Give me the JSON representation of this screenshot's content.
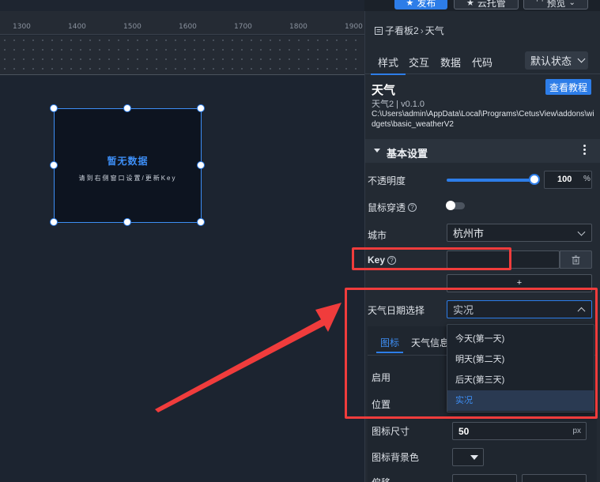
{
  "toolbar": {
    "publish_label": "发布",
    "host_label": "云托管",
    "preview_label": "预览"
  },
  "ruler": {
    "ticks": [
      "1300",
      "1400",
      "1500",
      "1600",
      "1700",
      "1800",
      "1900"
    ]
  },
  "widget": {
    "no_data_title": "暂无数据",
    "no_data_hint": "请到右侧窗口设置/更新Key"
  },
  "panel": {
    "breadcrumb_parent": "子看板2",
    "breadcrumb_current": "天气",
    "tabs": [
      "样式",
      "交互",
      "数据",
      "代码"
    ],
    "state_select": "默认状态",
    "widget_name": "天气",
    "tutorial_label": "查看教程",
    "widget_version": "天气2 | v0.1.0",
    "widget_path": "C:\\Users\\admin\\AppData\\Local\\Programs\\CetusView\\addons\\widgets\\basic_weatherV2",
    "section_title": "基本设置",
    "opacity": {
      "label": "不透明度",
      "value": "100",
      "unit": "%",
      "fraction": 1.0
    },
    "mouse_through": {
      "label": "鼠标穿透",
      "on": false
    },
    "city": {
      "label": "城市",
      "value": "杭州市"
    },
    "key": {
      "label": "Key",
      "value": ""
    },
    "add_label": "+",
    "date_select": {
      "label": "天气日期选择",
      "value": "实况",
      "options": [
        "今天(第一天)",
        "明天(第二天)",
        "后天(第三天)",
        "实况"
      ]
    },
    "subtabs": [
      "图标",
      "天气信息"
    ],
    "enable_label": "启用",
    "position_label": "位置",
    "icon_size": {
      "label": "图标尺寸",
      "value": "50",
      "unit": "px"
    },
    "icon_bg_label": "图标背景色",
    "partial_label": "偏移"
  },
  "colors": {
    "accent": "#2d7de8",
    "annotation": "#f03c3c"
  }
}
